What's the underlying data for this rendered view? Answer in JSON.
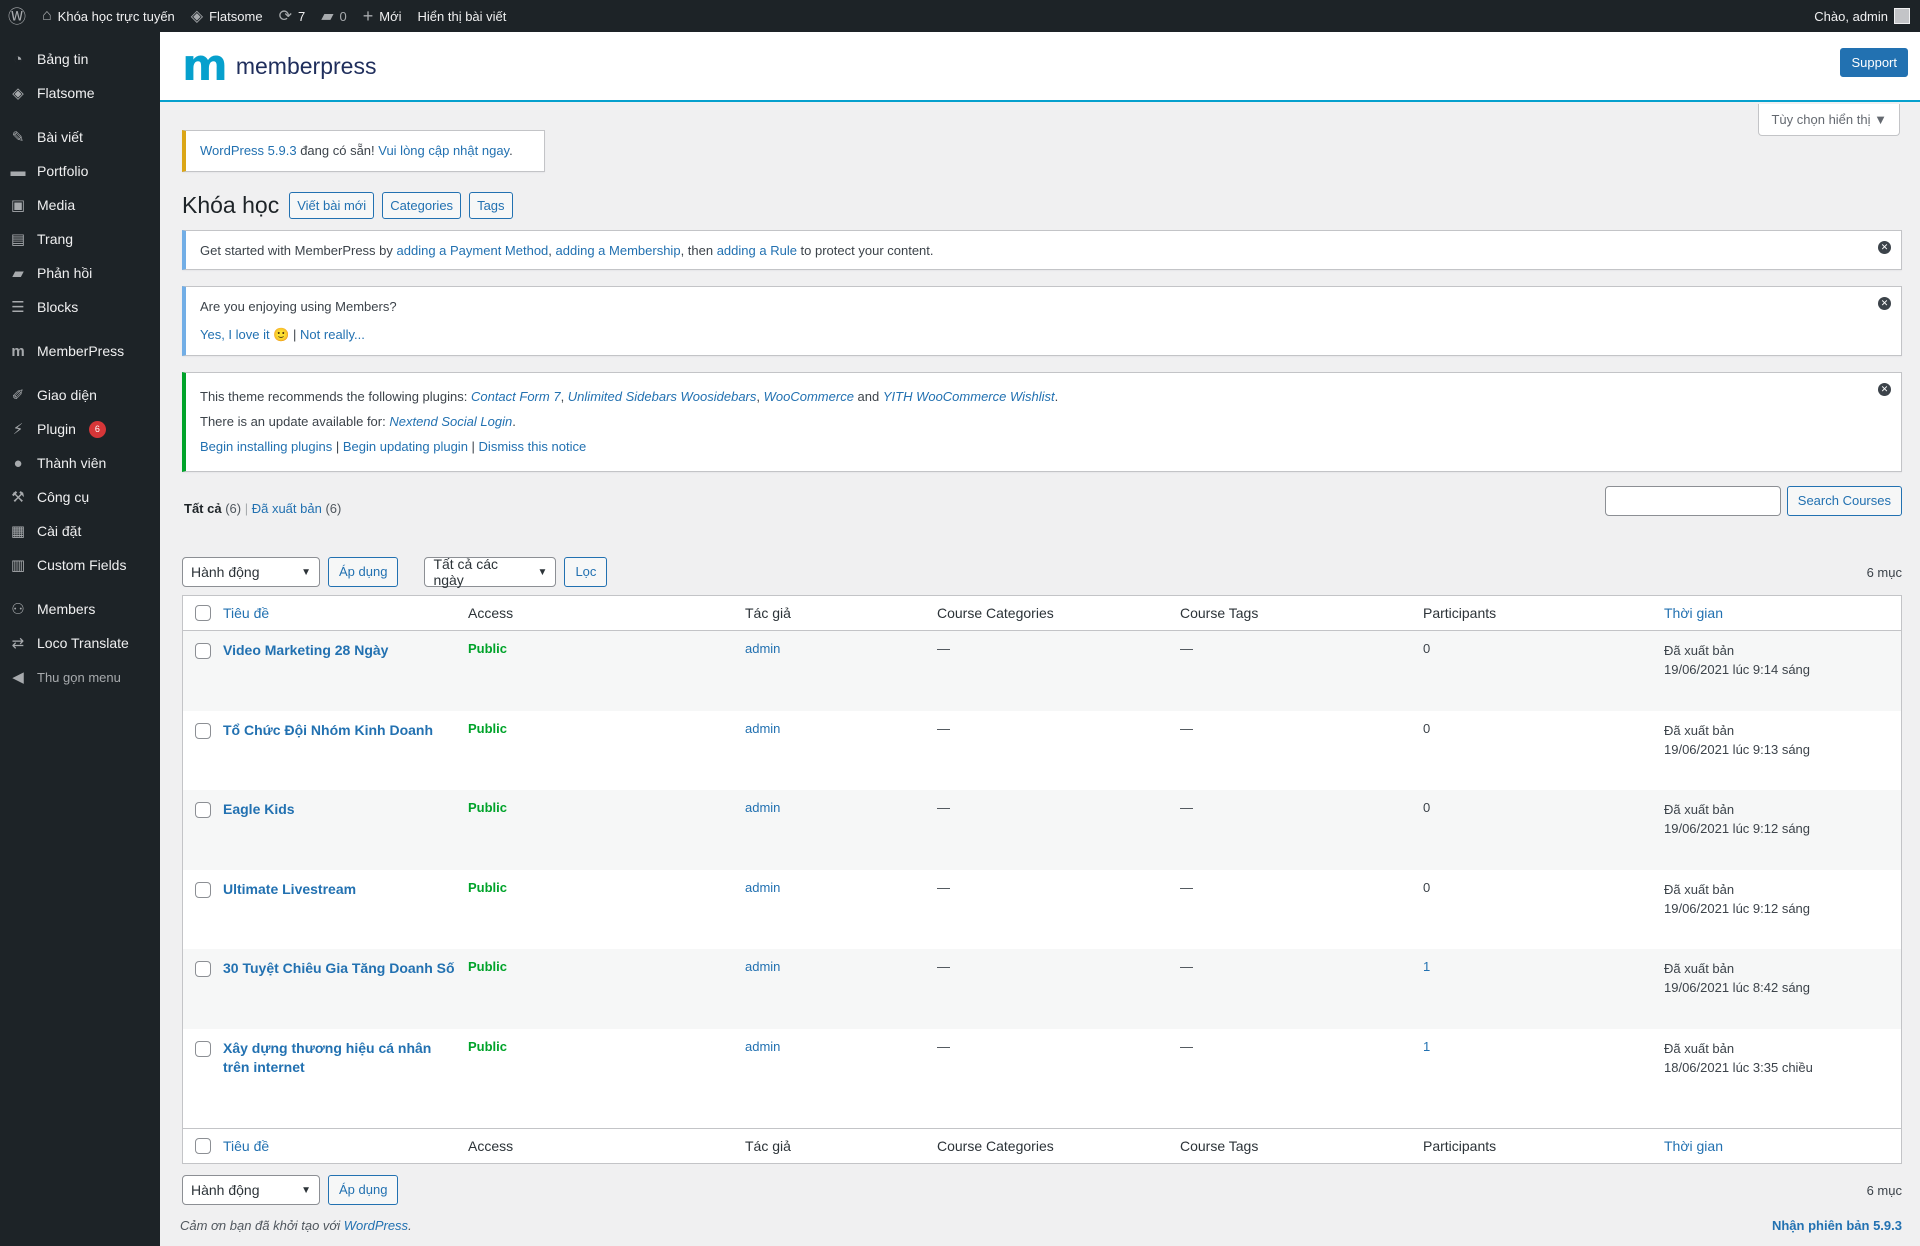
{
  "adminbar": {
    "site_name": "Khóa học trực tuyến",
    "theme_name": "Flatsome",
    "updates_count": "7",
    "comments_count": "0",
    "new_label": "Mới",
    "view_posts_label": "Hiển thị bài viết",
    "greeting": "Chào, admin"
  },
  "sidebar": {
    "items": [
      {
        "label": "Bảng tin",
        "icon": "dashboard-icon"
      },
      {
        "label": "Flatsome",
        "icon": "flatsome-icon"
      },
      {
        "label": "Bài viết",
        "icon": "pin-icon"
      },
      {
        "label": "Portfolio",
        "icon": "folder-icon"
      },
      {
        "label": "Media",
        "icon": "media-icon"
      },
      {
        "label": "Trang",
        "icon": "page-icon"
      },
      {
        "label": "Phản hồi",
        "icon": "comment-icon"
      },
      {
        "label": "Blocks",
        "icon": "blocks-icon"
      },
      {
        "label": "MemberPress",
        "icon": "memberpress-icon"
      },
      {
        "label": "Giao diện",
        "icon": "brush-icon"
      },
      {
        "label": "Plugin",
        "icon": "plugin-icon",
        "badge": "6"
      },
      {
        "label": "Thành viên",
        "icon": "user-icon"
      },
      {
        "label": "Công cụ",
        "icon": "wrench-icon"
      },
      {
        "label": "Cài đặt",
        "icon": "settings-icon"
      },
      {
        "label": "Custom Fields",
        "icon": "table-icon"
      },
      {
        "label": "Members",
        "icon": "members-icon"
      },
      {
        "label": "Loco Translate",
        "icon": "translate-icon"
      }
    ],
    "collapse_label": "Thu gọn menu"
  },
  "header": {
    "logo_text": "memberpress",
    "support_label": "Support"
  },
  "screen_options_label": "Tùy chọn hiển thị",
  "update_nag": {
    "link1": "WordPress 5.9.3",
    "text": " đang có sẵn! ",
    "link2": "Vui lòng cập nhật ngay",
    "end": "."
  },
  "page": {
    "title": "Khóa học",
    "actions": [
      "Viết bài mới",
      "Categories",
      "Tags"
    ]
  },
  "notice_start": {
    "t1": "Get started with MemberPress by ",
    "l1": "adding a Payment Method",
    "t2": ", ",
    "l2": "adding a Membership",
    "t3": ", then ",
    "l3": "adding a Rule",
    "t4": " to protect your content."
  },
  "notice_enjoy": {
    "question": "Are you enjoying using Members?",
    "yes": "Yes, I love it",
    "emoji": "🙂",
    "sep": " | ",
    "no": "Not really..."
  },
  "notice_plugins": {
    "l1_text": "This theme recommends the following plugins: ",
    "p1": "Contact Form 7",
    "p2": "Unlimited Sidebars Woosidebars",
    "p3": "WooCommerce",
    "and": " and ",
    "p4": "YITH WooCommerce Wishlist",
    "l2_text": "There is an update available for: ",
    "p5": "Nextend Social Login",
    "a1": "Begin installing plugins",
    "a2": "Begin updating plugin",
    "a3": "Dismiss this notice",
    "sep": " | "
  },
  "filters": {
    "all_label": "Tất cả",
    "all_count": "(6)",
    "published_label": "Đã xuất bản",
    "published_count": "(6)",
    "search_button": "Search Courses",
    "bulk_action": "Hành động",
    "apply": "Áp dụng",
    "dates": "Tất cả các ngày",
    "filter": "Lọc",
    "items_count": "6 mục"
  },
  "table": {
    "columns": [
      "Tiêu đề",
      "Access",
      "Tác giả",
      "Course Categories",
      "Course Tags",
      "Participants",
      "Thời gian"
    ],
    "rows": [
      {
        "title": "Video Marketing 28 Ngày",
        "access": "Public",
        "author": "admin",
        "cats": "—",
        "tags": "—",
        "participants": "0",
        "status": "Đã xuất bản",
        "date": "19/06/2021 lúc 9:14 sáng"
      },
      {
        "title": "Tổ Chức Đội Nhóm Kinh Doanh",
        "access": "Public",
        "author": "admin",
        "cats": "—",
        "tags": "—",
        "participants": "0",
        "status": "Đã xuất bản",
        "date": "19/06/2021 lúc 9:13 sáng"
      },
      {
        "title": "Eagle Kids",
        "access": "Public",
        "author": "admin",
        "cats": "—",
        "tags": "—",
        "participants": "0",
        "status": "Đã xuất bản",
        "date": "19/06/2021 lúc 9:12 sáng"
      },
      {
        "title": "Ultimate Livestream",
        "access": "Public",
        "author": "admin",
        "cats": "—",
        "tags": "—",
        "participants": "0",
        "status": "Đã xuất bản",
        "date": "19/06/2021 lúc 9:12 sáng"
      },
      {
        "title": "30 Tuyệt Chiêu Gia Tăng Doanh Số",
        "access": "Public",
        "author": "admin",
        "cats": "—",
        "tags": "—",
        "participants": "1",
        "status": "Đã xuất bản",
        "date": "19/06/2021 lúc 8:42 sáng"
      },
      {
        "title": "Xây dựng thương hiệu cá nhân trên internet",
        "access": "Public",
        "author": "admin",
        "cats": "—",
        "tags": "—",
        "participants": "1",
        "status": "Đã xuất bản",
        "date": "18/06/2021 lúc 3:35 chiều"
      }
    ]
  },
  "footer": {
    "thanks_text": "Cảm ơn bạn đã khởi tạo với ",
    "thanks_link": "WordPress",
    "thanks_end": ".",
    "version": "Nhận phiên bản 5.9.3"
  },
  "colors": {
    "accent": "#2271b1",
    "memberpress": "#06a0cd",
    "public_green": "#00a32a",
    "admin_dark": "#1d2327"
  }
}
